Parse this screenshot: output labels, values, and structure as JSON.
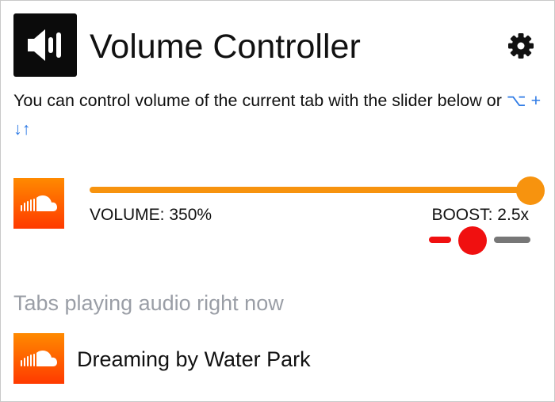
{
  "header": {
    "title": "Volume Controller",
    "logo_icon": "speaker-icon",
    "settings_icon": "gear-icon"
  },
  "description": {
    "text": "You can control volume of the current tab with the slider below or ",
    "shortcut": "⌥ + ↓↑"
  },
  "current_tab": {
    "icon": "soundcloud-icon",
    "volume": {
      "label": "VOLUME: 350%",
      "percent": 350,
      "fraction": 1.0
    },
    "boost": {
      "label": "BOOST: 2.5x",
      "value": 2.5,
      "fraction": 0.5
    }
  },
  "tabs_section": {
    "heading": "Tabs playing audio right now",
    "items": [
      {
        "icon": "soundcloud-icon",
        "title": "Dreaming by Water Park"
      }
    ]
  },
  "colors": {
    "volume_accent": "#f7930e",
    "boost_accent": "#f01010",
    "boost_track_rest": "#777777",
    "shortcut_text": "#2f7be5",
    "heading_muted": "#9a9ea6",
    "soundcloud_top": "#ff8a00",
    "soundcloud_bottom": "#ff3a00"
  }
}
